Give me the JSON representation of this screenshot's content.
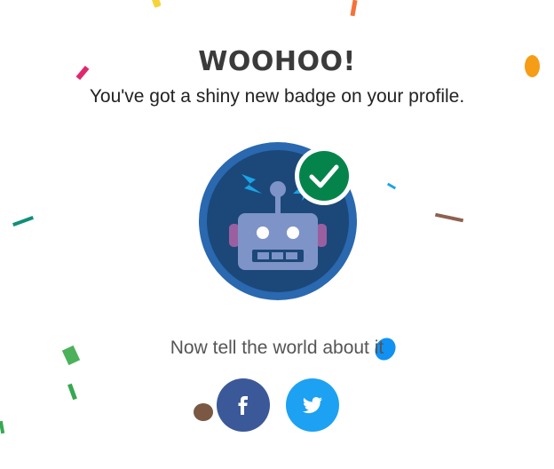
{
  "heading": "WOOHOO!",
  "message": "You've got a shiny new badge on your profile.",
  "badge": {
    "icon": "robot-icon",
    "status_icon": "checkmark-icon"
  },
  "share": {
    "prompt": "Now tell the world about it",
    "buttons": [
      {
        "network": "facebook",
        "icon": "facebook-icon",
        "color": "#3b5998"
      },
      {
        "network": "twitter",
        "icon": "twitter-icon",
        "color": "#1da1f2"
      }
    ]
  },
  "colors": {
    "badge_ring": "#2a68b0",
    "badge_fill": "#1b4878",
    "check_bg": "#04844b",
    "robot_body": "#7e93c8",
    "bolt": "#1aa4e8"
  }
}
